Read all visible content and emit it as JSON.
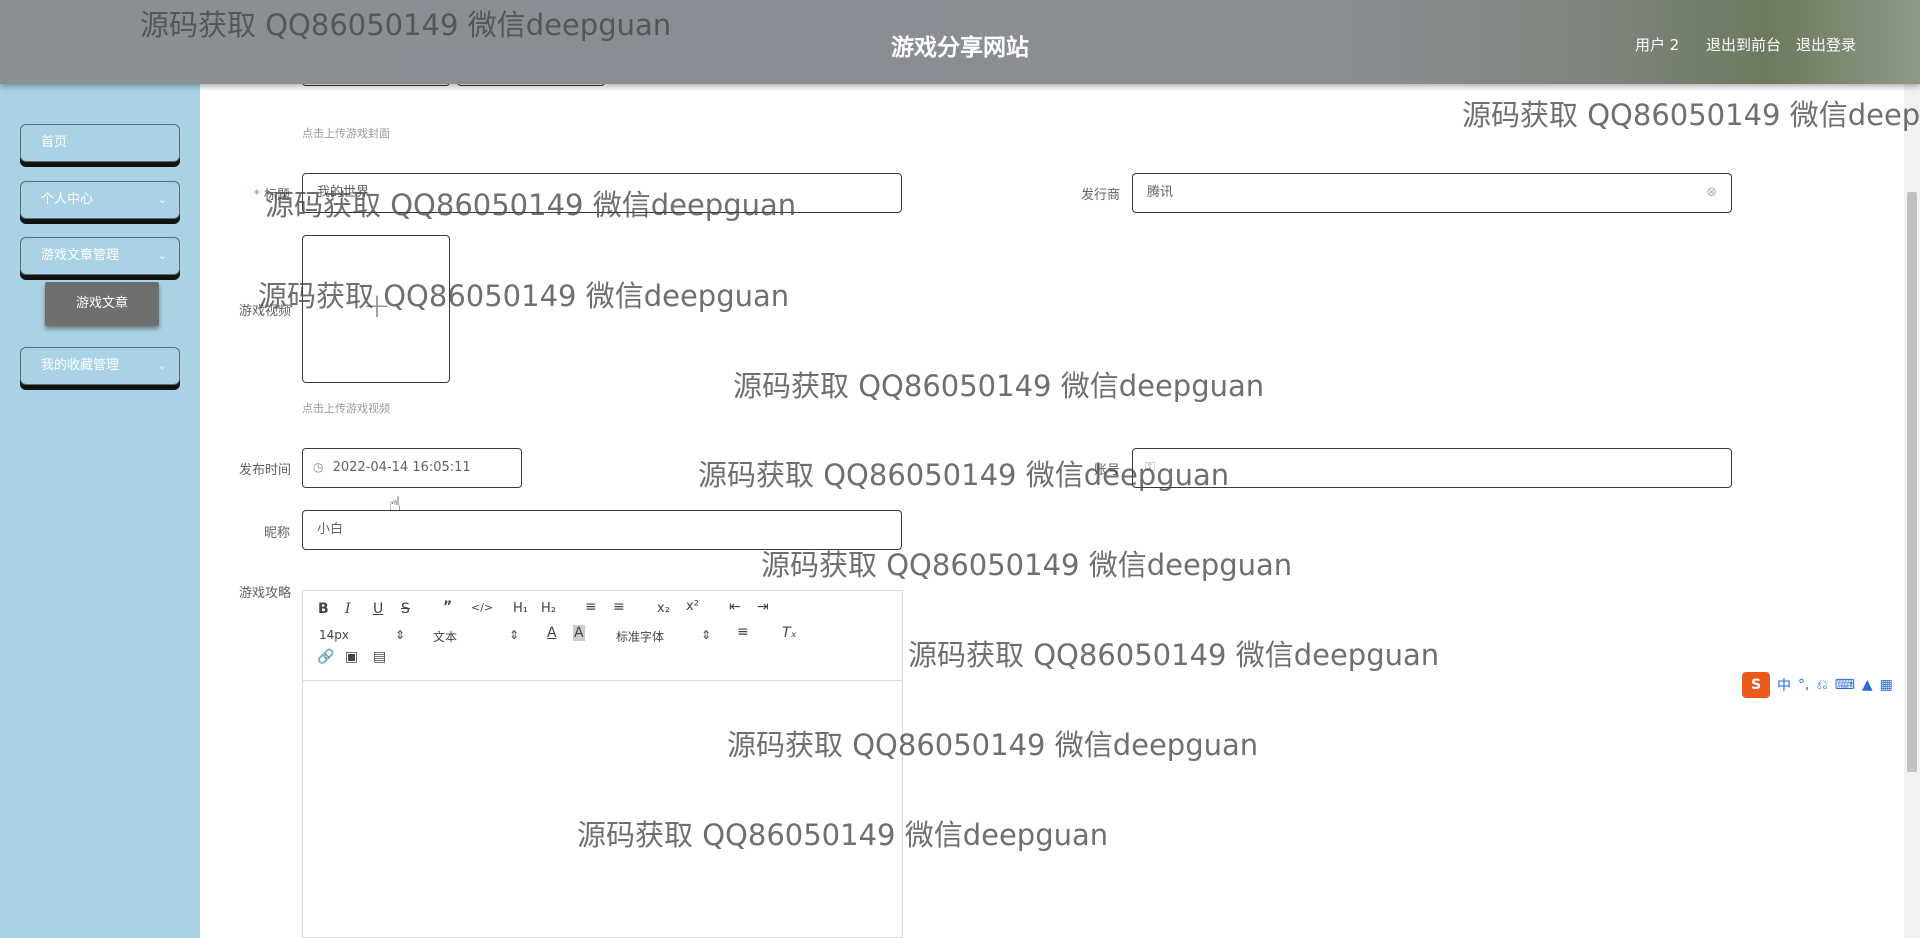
{
  "header": {
    "title": "游戏分享网站",
    "user": "用户 2",
    "front_link": "退出到前台",
    "logout": "退出登录"
  },
  "sidebar": {
    "items": [
      {
        "label": "首页"
      },
      {
        "label": "个人中心"
      },
      {
        "label": "游戏文章管理"
      },
      {
        "label": "我的收藏管理"
      }
    ],
    "sub_item": "游戏文章"
  },
  "form": {
    "cover_hint": "点击上传游戏封面",
    "title_label": "标题",
    "title_value": "我的世界",
    "publisher_label": "发行商",
    "publisher_value": "腾讯",
    "video_label": "游戏视频",
    "video_hint": "点击上传游戏视频",
    "publish_time_label": "发布时间",
    "publish_time_value": "2022-04-14 16:05:11",
    "account_label": "账号",
    "account_value": "",
    "nickname_label": "昵称",
    "nickname_value": "小白",
    "strategy_label": "游戏攻略"
  },
  "editor": {
    "font_size": "14px",
    "block_format": "文本",
    "font_family": "标准字体"
  },
  "ime": {
    "mode": "中"
  },
  "watermark": "源码获取 QQ86050149 微信deepguan"
}
